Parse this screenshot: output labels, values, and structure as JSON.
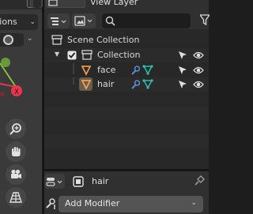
{
  "viewport": {
    "options_label": "ptions",
    "colors": {
      "x_axis": "#e8364c",
      "y_axis": "#7ec33a",
      "bg": "#3a3a3a"
    },
    "nav_buttons": [
      "zoom-icon",
      "hand-icon",
      "camera-icon",
      "grid-icon"
    ]
  },
  "outliner": {
    "view_layer_label": "View Layer",
    "search": {
      "value": "",
      "placeholder": ""
    },
    "tree": [
      {
        "label": "Scene Collection",
        "icon": "scene-collection-icon"
      },
      {
        "label": "Collection",
        "icon": "collection-icon",
        "checked": true,
        "expanded": true
      },
      {
        "label": "face",
        "icon": "mesh-object-icon",
        "modifiers": [
          "wrench-icon",
          "vertex-group-icon"
        ]
      },
      {
        "label": "hair",
        "icon": "mesh-object-icon",
        "active": true,
        "modifiers": [
          "wrench-icon",
          "vertex-group-icon"
        ]
      }
    ],
    "colors": {
      "object_icon": "#e8974c",
      "wrench": "#5a8ad6",
      "vgroup": "#2bc0b0"
    }
  },
  "properties": {
    "object_name": "hair",
    "add_modifier_label": "Add Modifier"
  }
}
